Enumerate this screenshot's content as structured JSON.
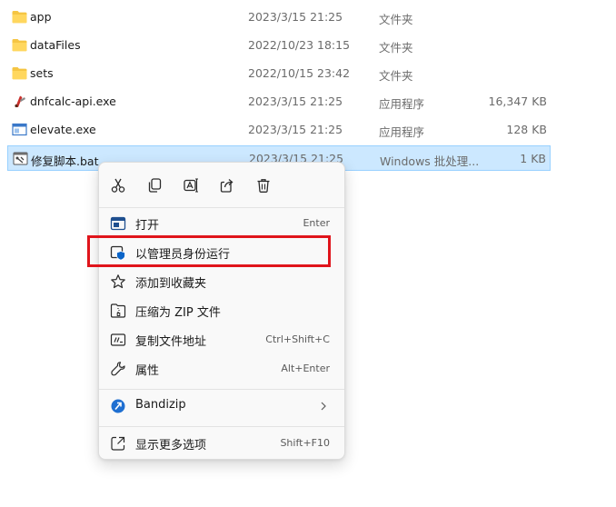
{
  "files": [
    {
      "name": "app",
      "date": "2023/3/15 21:25",
      "type": "文件夹",
      "size": "",
      "icon": "folder-icon"
    },
    {
      "name": "dataFiles",
      "date": "2022/10/23 18:15",
      "type": "文件夹",
      "size": "",
      "icon": "folder-icon"
    },
    {
      "name": "sets",
      "date": "2022/10/15 23:42",
      "type": "文件夹",
      "size": "",
      "icon": "folder-icon"
    },
    {
      "name": "dnfcalc-api.exe",
      "date": "2023/3/15 21:25",
      "type": "应用程序",
      "size": "16,347 KB",
      "icon": "app-exe-icon"
    },
    {
      "name": "elevate.exe",
      "date": "2023/3/15 21:25",
      "type": "应用程序",
      "size": "128 KB",
      "icon": "window-exe-icon"
    },
    {
      "name": "修复脚本.bat",
      "date": "2023/3/15 21:25",
      "type": "Windows 批处理...",
      "size": "1 KB",
      "icon": "batch-file-icon",
      "selected": true
    }
  ],
  "quick_actions": [
    "cut-icon",
    "copy-icon",
    "rename-icon",
    "share-icon",
    "delete-icon"
  ],
  "menu": {
    "open": {
      "label": "打开",
      "shortcut": "Enter",
      "icon": "open-icon"
    },
    "run_as_admin": {
      "label": "以管理员身份运行",
      "icon": "shield-icon"
    },
    "add_favorites": {
      "label": "添加到收藏夹",
      "icon": "star-icon"
    },
    "compress_zip": {
      "label": "压缩为 ZIP 文件",
      "icon": "zip-icon"
    },
    "copy_path": {
      "label": "复制文件地址",
      "shortcut": "Ctrl+Shift+C",
      "icon": "path-icon"
    },
    "properties": {
      "label": "属性",
      "shortcut": "Alt+Enter",
      "icon": "wrench-icon"
    },
    "bandizip": {
      "label": "Bandizip",
      "icon": "bandizip-icon"
    },
    "more_options": {
      "label": "显示更多选项",
      "shortcut": "Shift+F10",
      "icon": "more-options-icon"
    }
  },
  "colors": {
    "folder": "#f5c543",
    "selection": "#cce8ff",
    "selection_border": "#99d1ff",
    "highlight": "#e0141b",
    "accent": "#0a64c8"
  }
}
